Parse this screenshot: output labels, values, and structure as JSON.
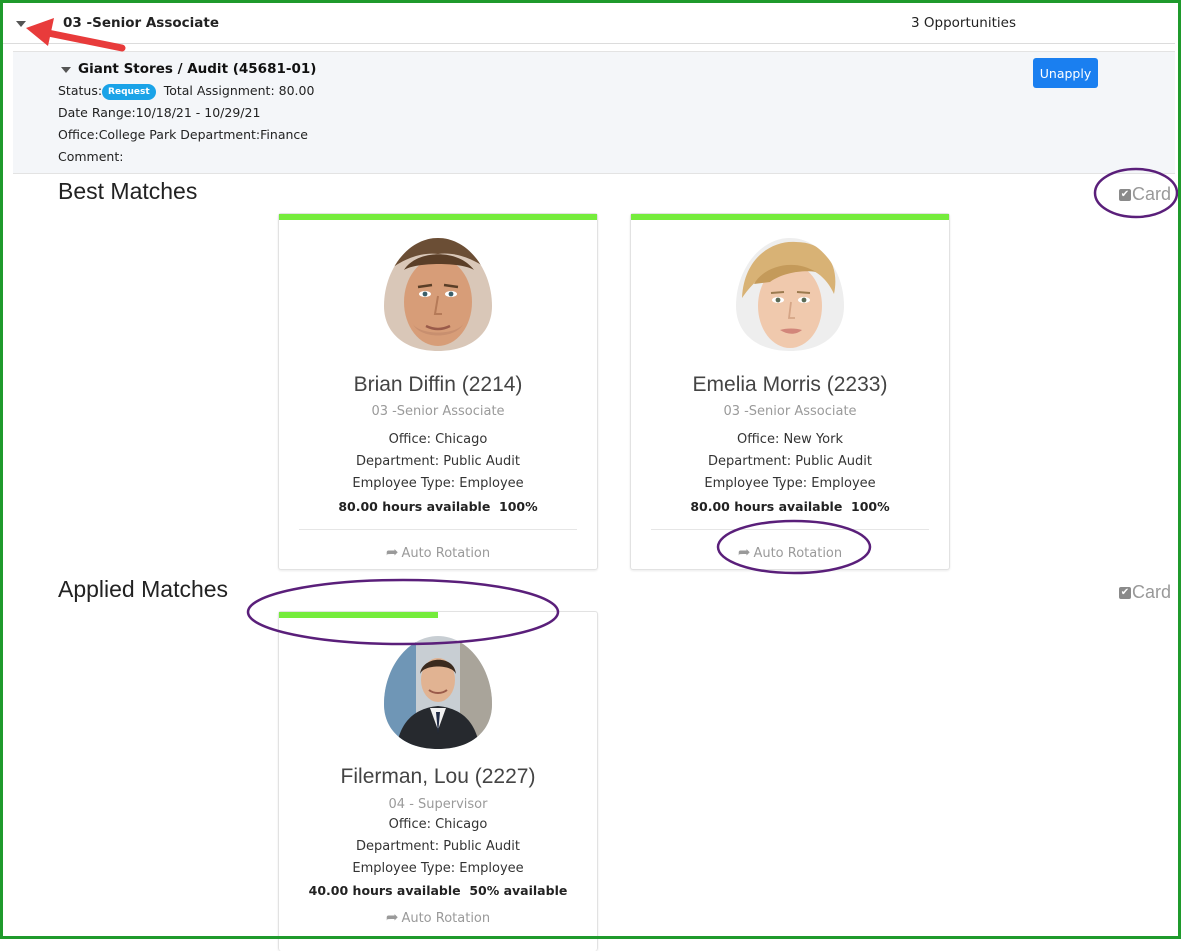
{
  "group": {
    "title": "03 -Senior Associate",
    "count": "3 Opportunities"
  },
  "assignment": {
    "title": "Giant Stores / Audit (45681-01)",
    "status_label": "Status:",
    "status_badge": "Request",
    "total": "Total Assignment: 80.00",
    "date_range": "Date Range:10/18/21 - 10/29/21",
    "office_dept": "Office:College Park Department:Finance",
    "comment": "Comment:",
    "unapply_label": "Unapply"
  },
  "best_matches": {
    "title": "Best Matches",
    "toggle_label": "Card",
    "cards": [
      {
        "name": "Brian Diffin (2214)",
        "role": "03 -Senior Associate",
        "office": "Office: Chicago",
        "department": "Department: Public Audit",
        "type": "Employee Type: Employee",
        "hours": "80.00 hours available  100%",
        "action": "Auto Rotation",
        "match_fill": 1.0
      },
      {
        "name": "Emelia Morris (2233)",
        "role": "03 -Senior Associate",
        "office": "Office: New York",
        "department": "Department: Public Audit",
        "type": "Employee Type: Employee",
        "hours": "80.00 hours available  100%",
        "action": "Auto Rotation",
        "match_fill": 1.0
      }
    ]
  },
  "applied_matches": {
    "title": "Applied Matches",
    "toggle_label": "Card",
    "cards": [
      {
        "name": "Filerman, Lou (2227)",
        "role": "04 - Supervisor",
        "office": "Office: Chicago",
        "department": "Department: Public Audit",
        "type": "Employee Type: Employee",
        "hours": "40.00 hours available  50% available",
        "action": "Auto Rotation",
        "match_fill": 0.5
      }
    ]
  },
  "colors": {
    "frame": "#1f9a2c",
    "primary_button": "#1a7ff0",
    "badge": "#1aa3e8",
    "match_bar": "#75ec3c",
    "annotation_ellipse": "#5a1f7a",
    "annotation_arrow": "#e83b3b"
  }
}
